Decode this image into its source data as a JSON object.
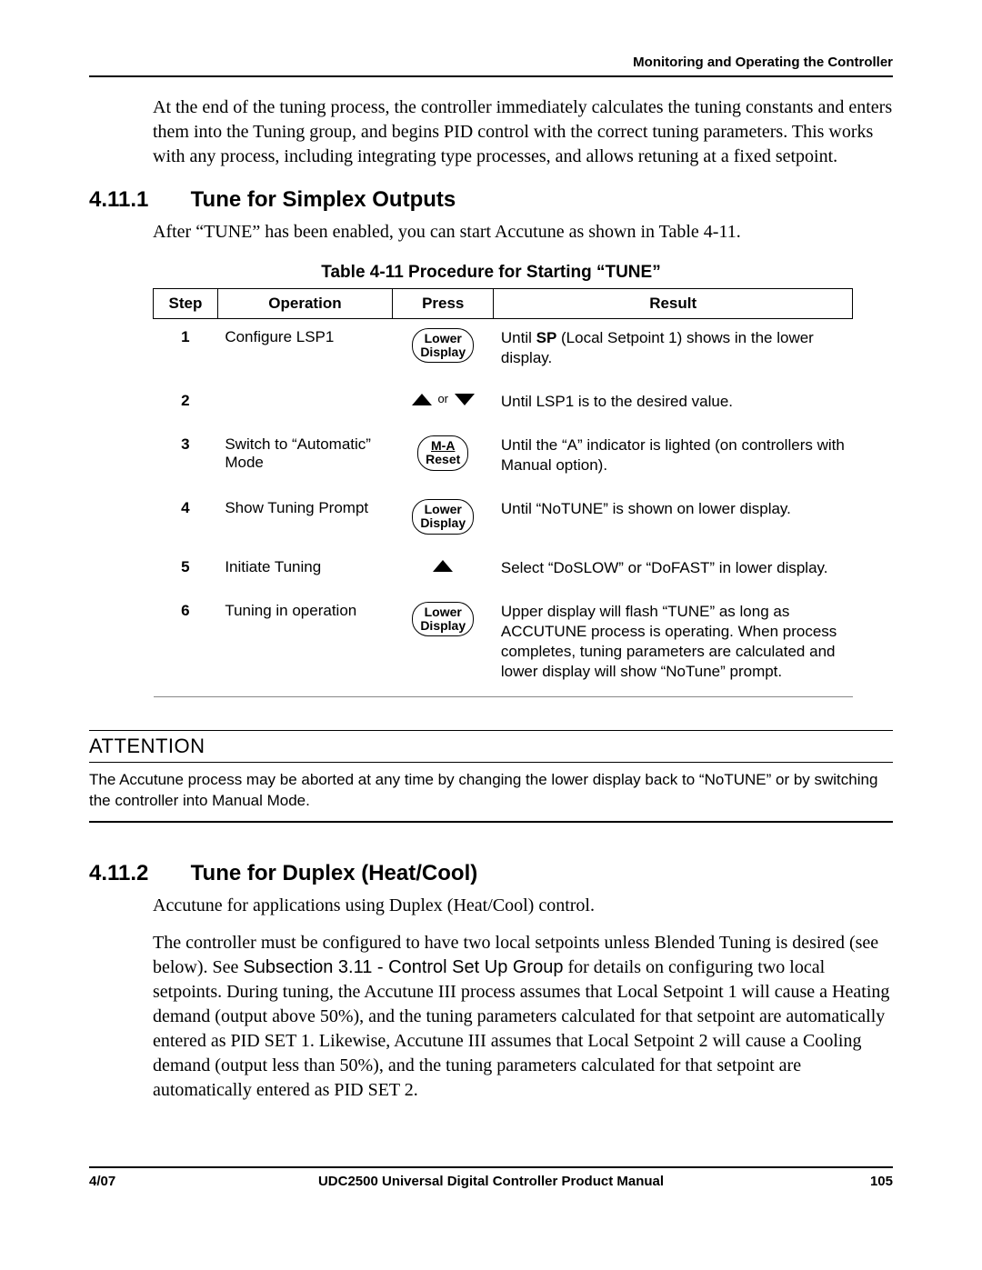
{
  "running_head": "Monitoring and Operating the Controller",
  "intro_para": "At the end of the tuning process, the controller immediately calculates the tuning constants and enters them into the Tuning group, and begins PID control with the correct tuning parameters.  This works with any process, including integrating type processes, and allows retuning at a fixed setpoint.",
  "sec_4_11_1": {
    "number": "4.11.1",
    "title": "Tune for Simplex Outputs",
    "para": "After “TUNE” has been enabled, you can start Accutune as shown in Table 4-11."
  },
  "table": {
    "caption": "Table 4-11  Procedure for Starting “TUNE”",
    "headers": {
      "step": "Step",
      "operation": "Operation",
      "press": "Press",
      "result": "Result"
    },
    "keys": {
      "lower_display_l1": "Lower",
      "lower_display_l2": "Display",
      "ma_reset_l1": "M-A",
      "ma_reset_l2": "Reset",
      "or": "or"
    },
    "rows": [
      {
        "step": "1",
        "operation": "Configure LSP1",
        "press_type": "lower_display",
        "result_pre": "Until ",
        "result_bold": "SP",
        "result_post": " (Local Setpoint 1) shows in the lower display."
      },
      {
        "step": "2",
        "operation": "",
        "press_type": "up_or_down",
        "result": "Until LSP1 is to the desired value."
      },
      {
        "step": "3",
        "operation": "Switch to “Automatic” Mode",
        "press_type": "ma_reset",
        "result": "Until the “A” indicator is lighted (on controllers with Manual option)."
      },
      {
        "step": "4",
        "operation": "Show Tuning Prompt",
        "press_type": "lower_display",
        "result": "Until “NoTUNE” is shown on lower display."
      },
      {
        "step": "5",
        "operation": "Initiate Tuning",
        "press_type": "up",
        "result": "Select “DoSLOW” or “DoFAST” in lower display."
      },
      {
        "step": "6",
        "operation": "Tuning in operation",
        "press_type": "lower_display",
        "result": "Upper display will flash “TUNE” as long as ACCUTUNE process is operating.  When process completes, tuning parameters are calculated and lower display will show “NoTune” prompt."
      }
    ]
  },
  "attention": {
    "title": "ATTENTION",
    "body": "The Accutune process may be aborted at any time by changing the lower display back to “NoTUNE” or by switching the controller into Manual Mode."
  },
  "sec_4_11_2": {
    "number": "4.11.2",
    "title": "Tune for Duplex (Heat/Cool)",
    "para1": "Accutune for applications using Duplex (Heat/Cool) control.",
    "para2_a": "The controller must be configured to have two local setpoints unless Blended Tuning is desired (see below). See ",
    "para2_link": "Subsection 3.11 - Control Set Up Group",
    "para2_b": " for details on configuring two local setpoints. During tuning, the Accutune III process assumes that Local Setpoint 1 will cause a Heating demand (output above 50%), and the tuning parameters calculated for that setpoint are automatically entered as PID SET 1. Likewise, Accutune III assumes that Local Setpoint 2 will cause a Cooling demand (output less than 50%), and the tuning parameters calculated for that setpoint are automatically entered as PID SET 2."
  },
  "footer": {
    "left": "4/07",
    "center": "UDC2500 Universal Digital Controller Product Manual",
    "right": "105"
  }
}
